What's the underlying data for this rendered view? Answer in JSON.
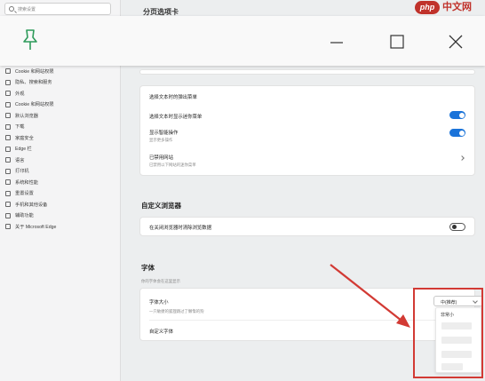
{
  "watermark": {
    "php": "php",
    "site": "中文网"
  },
  "sidebar": {
    "search_placeholder": "搜索设置",
    "items": [
      {
        "label": "Cookie 和网站权限"
      },
      {
        "label": "隐私、搜索和服务"
      },
      {
        "label": "外观"
      },
      {
        "label": "Cookie 和网站权限"
      },
      {
        "label": "默认浏览器"
      },
      {
        "label": "下载"
      },
      {
        "label": "家庭安全"
      },
      {
        "label": "Edge 栏"
      },
      {
        "label": "语言"
      },
      {
        "label": "打印机"
      },
      {
        "label": "系统和性能"
      },
      {
        "label": "重置设置"
      },
      {
        "label": "手机和其他设备"
      },
      {
        "label": "辅助功能"
      },
      {
        "label": "关于 Microsoft Edge"
      }
    ]
  },
  "main": {
    "partial_title": "分页选项卡",
    "card1": {
      "header": "选择文本时的弹出菜单",
      "rows": [
        {
          "title": "选择文本时显示迷你菜单",
          "toggle": true
        },
        {
          "title": "显示智能操作",
          "sub": "显示更多操作",
          "toggle": true
        },
        {
          "title": "已禁用网站",
          "sub": "已禁用以下网站的迷你菜单",
          "chevron": true
        }
      ]
    },
    "custom_section": {
      "title": "自定义浏览器",
      "row": {
        "title": "在关闭浏览器时清除浏览数据",
        "toggle": false
      }
    },
    "font_section": {
      "title": "字体",
      "note": "你的字体会在这里显示",
      "font_size": {
        "title": "字体大小",
        "sub": "一只敏捷的狐狸跳过了懒惰的狗",
        "value": "中(推荐)",
        "menu_first": "非常小"
      },
      "custom_font": {
        "title": "自定义字体"
      }
    }
  },
  "colors": {
    "accent": "#1a73d9",
    "annotation": "#d23a34",
    "pin": "#2e9b5a"
  }
}
